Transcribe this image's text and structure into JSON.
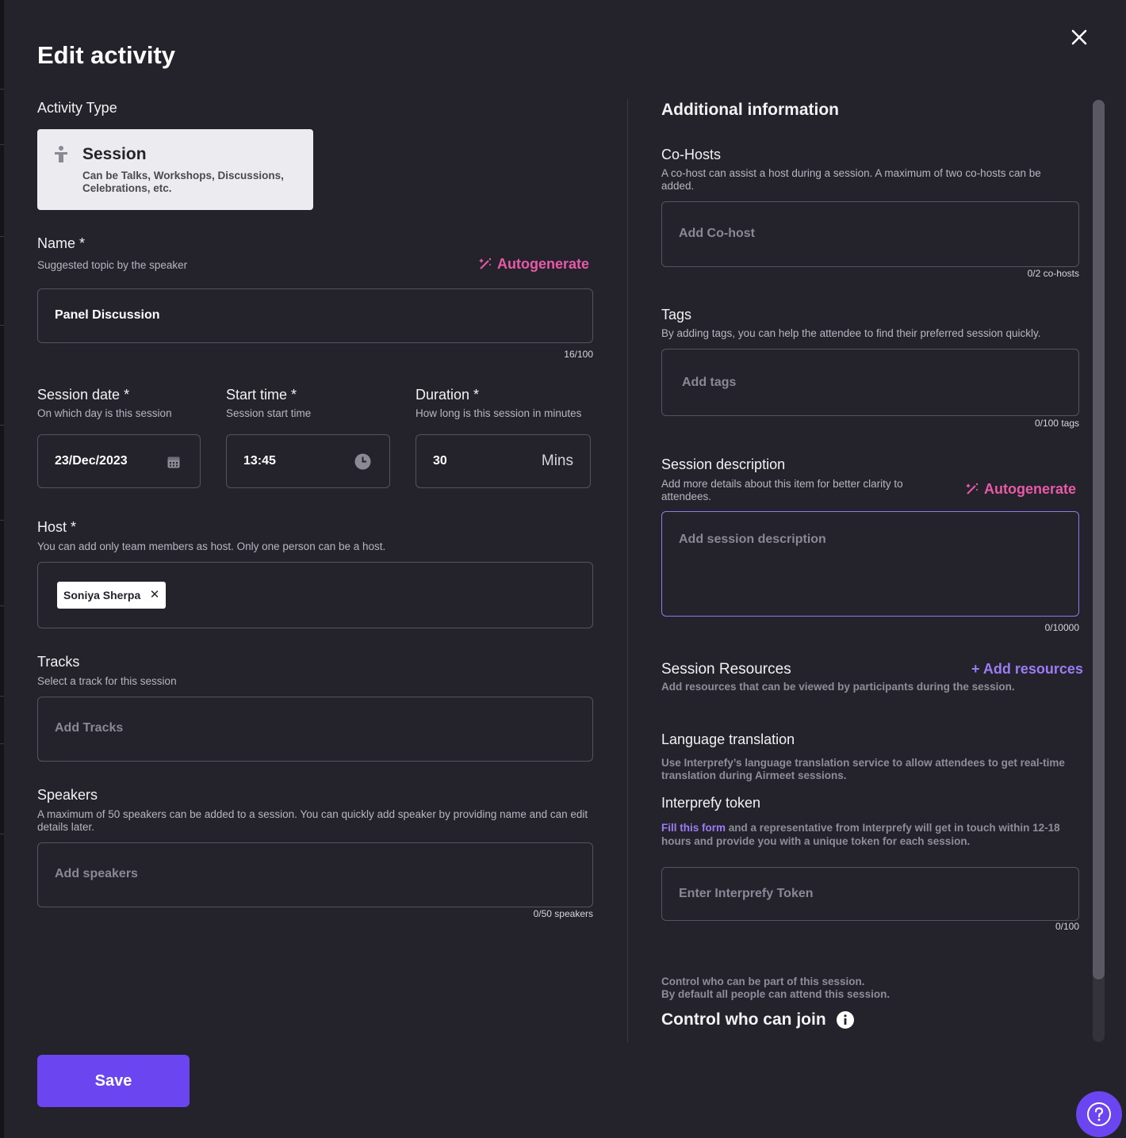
{
  "dialog": {
    "title": "Edit activity",
    "save_label": "Save"
  },
  "activity_type": {
    "label": "Activity Type",
    "card_title": "Session",
    "card_desc": "Can be Talks, Workshops, Discussions, Celebrations, etc.",
    "icon": "podium-icon"
  },
  "name": {
    "label": "Name *",
    "help": "Suggested topic by the speaker",
    "autogenerate": "Autogenerate",
    "value": "Panel Discussion",
    "counter": "16/100"
  },
  "session_date": {
    "label": "Session date *",
    "help": "On which day is this session",
    "value": "23/Dec/2023",
    "icon": "calendar-icon"
  },
  "start_time": {
    "label": "Start time *",
    "help": "Session start time",
    "value": "13:45",
    "icon": "clock-icon"
  },
  "duration": {
    "label": "Duration *",
    "help": "How long is this session in minutes",
    "value": "30",
    "unit": "Mins"
  },
  "host": {
    "label": "Host *",
    "help": "You can add only team members as host. Only one person can be a host.",
    "chip": "Soniya Sherpa",
    "chip_remove": "✕"
  },
  "tracks": {
    "label": "Tracks",
    "help": "Select a track for this session",
    "placeholder": "Add Tracks"
  },
  "speakers": {
    "label": "Speakers",
    "help": "A maximum of 50 speakers can be added to a session. You can quickly add speaker by providing name and can edit details later.",
    "placeholder": "Add speakers",
    "counter": "0/50 speakers"
  },
  "additional": {
    "heading": "Additional information",
    "cohosts": {
      "label": "Co-Hosts",
      "help": "A co-host can assist a host during a session. A maximum of two co-hosts can be added.",
      "placeholder": "Add Co-host",
      "counter": "0/2 co-hosts"
    },
    "tags": {
      "label": "Tags",
      "help": "By adding tags, you can help the attendee to find their preferred session quickly.",
      "placeholder": "Add tags",
      "counter": "0/100 tags"
    },
    "description": {
      "label": "Session description",
      "help": "Add more details about this item for better clarity to attendees.",
      "autogenerate": "Autogenerate",
      "placeholder": "Add session description",
      "counter": "0/10000"
    },
    "resources": {
      "label": "Session Resources",
      "help": "Add resources that can be viewed by participants during the session.",
      "add": "+ Add resources"
    },
    "translation": {
      "label": "Language translation",
      "help": "Use Interprefy’s language translation service to allow attendees to get real-time translation during Airmeet sessions.",
      "token_label": "Interprefy token",
      "token_link": "Fill this form",
      "token_help": " and a representative from Interprefy will get in touch within 12-18 hours and provide you with a unique token for each session.",
      "placeholder": "Enter Interprefy Token",
      "counter": "0/100"
    },
    "control": {
      "help_line1": "Control who can be part of this session.",
      "help_line2": "By default all people can attend this session.",
      "label": "Control who can join"
    }
  }
}
